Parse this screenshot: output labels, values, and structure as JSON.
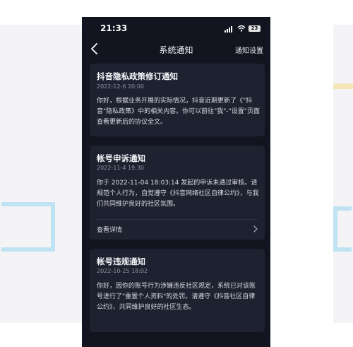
{
  "status_bar": {
    "time": "21:33",
    "battery": "23"
  },
  "nav": {
    "title": "系统通知",
    "settings_label": "通知设置"
  },
  "notifications": [
    {
      "title": "抖音隐私政策修订通知",
      "date": "2022-12-6 20:00",
      "body": "你好，根据业务开展的实际情况，抖音近期更新了《\"抖音\"隐私政策》中的相关内容。你可以前往\"我\"-\"设置\"页面查看更新后的协议全文。"
    },
    {
      "title": "帐号申诉通知",
      "date": "2022-11-4 19:30",
      "body": "你于 2022-11-04 18:03:14 发起的申诉未通过审核。请规范个人行为，自觉遵守《抖音网络社区自律公约》，与我们共同维护良好的社区氛围。",
      "detail_label": "查看详情"
    },
    {
      "title": "帐号违规通知",
      "date": "2022-10-25 18:02",
      "body": "你好，因你的账号行为涉嫌违反社区规定，系统已对该账号进行了\"重置个人资料\"的处罚。请遵守《抖音社区自律公约》，共同维护良好的社区生态。"
    }
  ]
}
